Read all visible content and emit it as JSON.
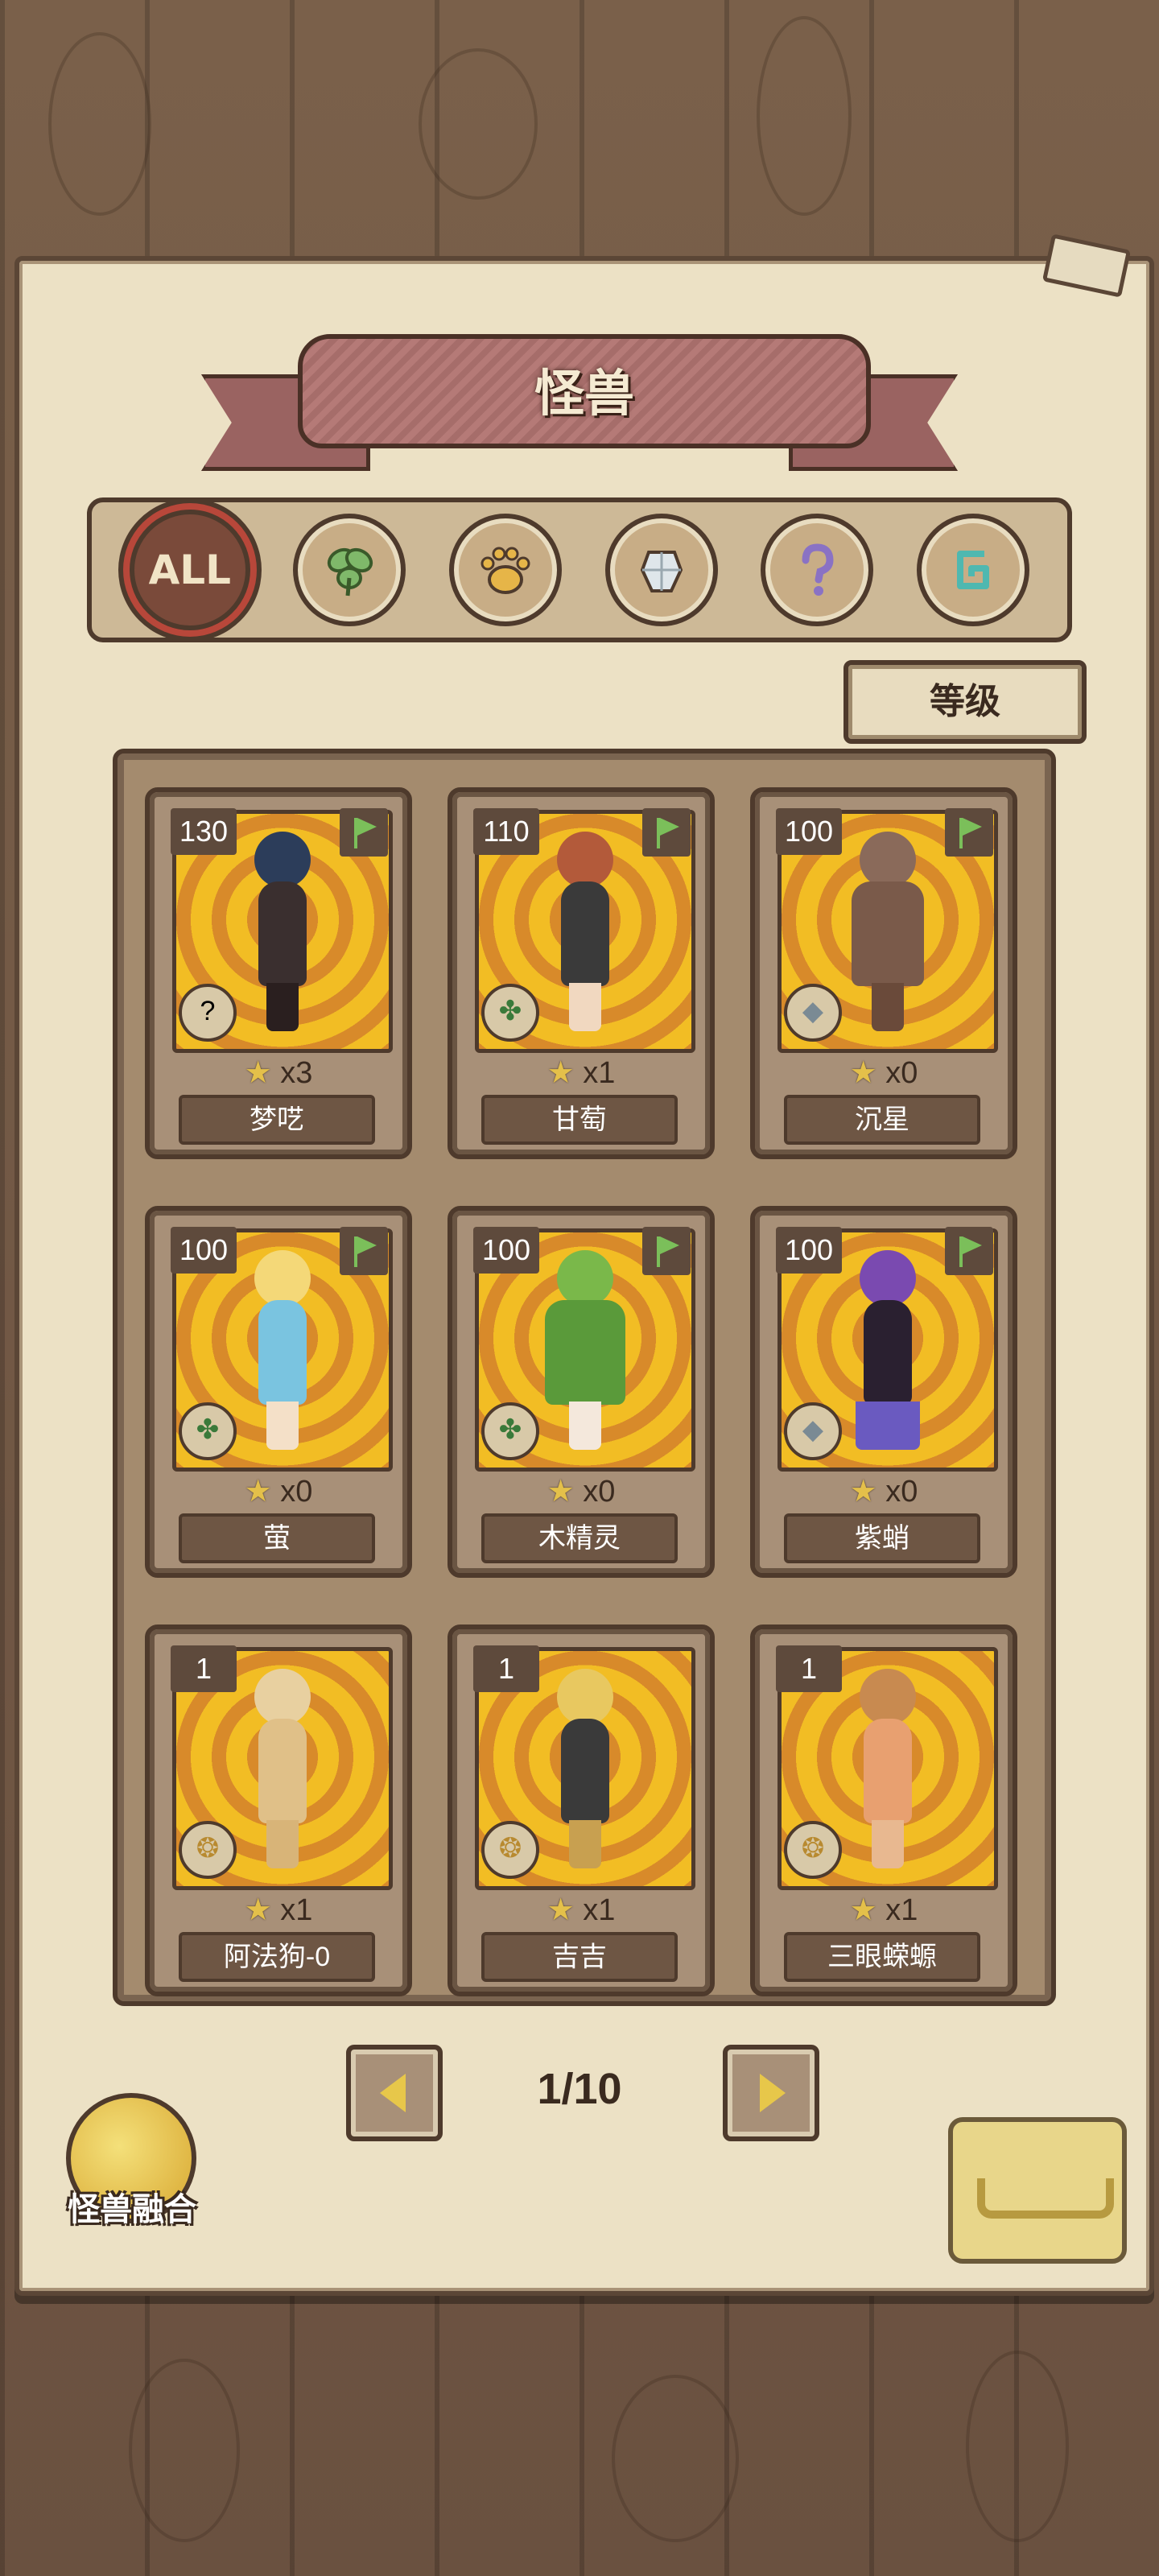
{
  "title": "怪兽",
  "filters": [
    {
      "label": "ALL",
      "icon": "all-icon",
      "active": true
    },
    {
      "label": "",
      "icon": "leaf-icon"
    },
    {
      "label": "",
      "icon": "paw-icon"
    },
    {
      "label": "",
      "icon": "crystal-icon"
    },
    {
      "label": "",
      "icon": "question-icon"
    },
    {
      "label": "",
      "icon": "spiral-icon"
    }
  ],
  "sort_label": "等级",
  "cards": [
    {
      "level": "130",
      "stars": "x3",
      "name": "梦呓",
      "element": "question-icon"
    },
    {
      "level": "110",
      "stars": "x1",
      "name": "甘萄",
      "element": "leaf-icon"
    },
    {
      "level": "100",
      "stars": "x0",
      "name": "沉星",
      "element": "crystal-icon"
    },
    {
      "level": "100",
      "stars": "x0",
      "name": "萤",
      "element": "leaf-icon"
    },
    {
      "level": "100",
      "stars": "x0",
      "name": "木精灵",
      "element": "leaf-icon"
    },
    {
      "level": "100",
      "stars": "x0",
      "name": "紫蛸",
      "element": "crystal-icon"
    },
    {
      "level": "1",
      "stars": "x1",
      "name": "阿法狗-0",
      "element": "paw-icon"
    },
    {
      "level": "1",
      "stars": "x1",
      "name": "吉吉",
      "element": "paw-icon"
    },
    {
      "level": "1",
      "stars": "x1",
      "name": "三眼蝾螈",
      "element": "paw-icon"
    }
  ],
  "pager": {
    "text": "1/10"
  },
  "fusion_label": "怪兽融合",
  "colors": {
    "accent": "#b8473a",
    "paper": "#ece1c5",
    "wood": "#6b5240"
  }
}
